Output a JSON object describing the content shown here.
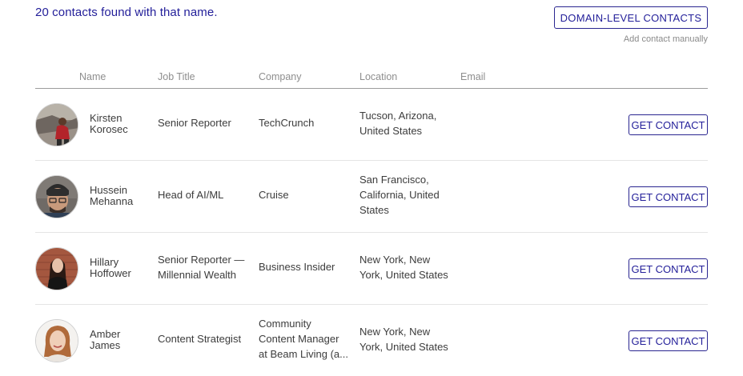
{
  "header": {
    "results_text": "20 contacts found with that name.",
    "domain_button": "DOMAIN-LEVEL CONTACTS",
    "add_manual": "Add contact manually"
  },
  "columns": [
    "Name",
    "Job Title",
    "Company",
    "Location",
    "Email"
  ],
  "get_contact_label": "GET CONTACT",
  "contacts": [
    {
      "first": "Kirsten",
      "last": "Korosec",
      "title": [
        "Senior Reporter"
      ],
      "company": [
        "TechCrunch"
      ],
      "location": [
        "Tucson, Arizona,",
        "United States"
      ],
      "avatar_icon": "person-photo-icon"
    },
    {
      "first": "Hussein",
      "last": "Mehanna",
      "title": [
        "Head of AI/ML"
      ],
      "company": [
        "Cruise"
      ],
      "location": [
        "San Francisco,",
        "California, United",
        "States"
      ],
      "avatar_icon": "person-photo-icon"
    },
    {
      "first": "Hillary",
      "last": "Hoffower",
      "title": [
        "Senior Reporter —",
        "Millennial Wealth"
      ],
      "company": [
        "Business Insider"
      ],
      "location": [
        "New York, New",
        "York, United States"
      ],
      "avatar_icon": "person-photo-icon"
    },
    {
      "first": "Amber",
      "last": "James",
      "title": [
        "Content Strategist"
      ],
      "company": [
        "Community",
        "Content Manager",
        "at Beam Living (a..."
      ],
      "location": [
        "New York, New",
        "York, United States"
      ],
      "avatar_icon": "person-photo-icon"
    }
  ],
  "colors": {
    "accent": "#24209a",
    "text": "#3c3c3c",
    "muted": "#8e8e8e",
    "divider": "#e4e4e4"
  }
}
